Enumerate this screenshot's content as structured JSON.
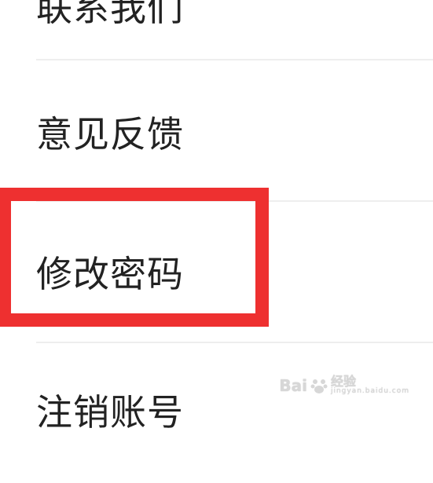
{
  "menu": {
    "items": [
      {
        "label": "联系我们"
      },
      {
        "label": "意见反馈"
      },
      {
        "label": "修改密码"
      },
      {
        "label": "注销账号"
      }
    ]
  },
  "colors": {
    "highlight": "#ee3030",
    "divider": "#eeeeee",
    "text": "#222222"
  },
  "watermark": {
    "brand": "Bai",
    "suffix": "经验",
    "subtext": "jingyan.baidu.com"
  }
}
